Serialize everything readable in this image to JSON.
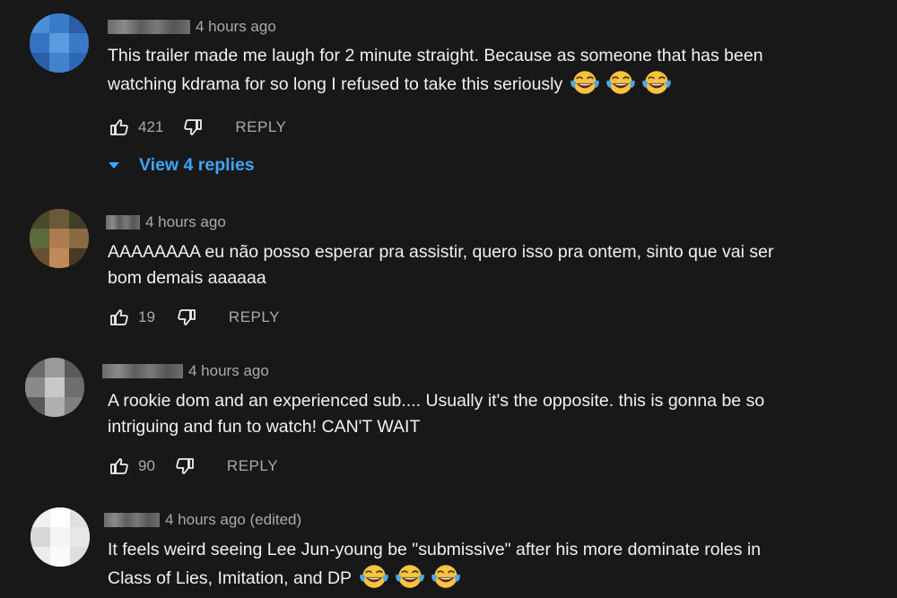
{
  "comments": [
    {
      "time": "4 hours ago",
      "text_lines": [
        "This trailer made me laugh for 2 minute straight. Because as someone that has been",
        "watching kdrama for so long I refused to take this seriously"
      ],
      "emoji": "face-with-tears-of-joy",
      "emoji_count": 3,
      "likes": "421",
      "reply_label": "REPLY",
      "view_replies_label": "View 4 replies",
      "avatar_color": "#3a78c4"
    },
    {
      "time": "4 hours ago",
      "text_lines": [
        "AAAAAAAA eu não posso esperar pra assistir, quero isso pra ontem, sinto que vai ser",
        "bom demais aaaaaa"
      ],
      "likes": "19",
      "reply_label": "REPLY",
      "avatar_color": "#6b5a3a"
    },
    {
      "time": "4 hours ago",
      "text_lines": [
        "A rookie dom and an experienced sub.... Usually it's the opposite. this is gonna be so",
        "intriguing and fun to watch! CAN'T WAIT"
      ],
      "likes": "90",
      "reply_label": "REPLY",
      "avatar_color": "#8a8a8a"
    },
    {
      "time": "4 hours ago (edited)",
      "text_lines": [
        "It feels weird seeing Lee Jun-young be \"submissive\" after his more dominate roles in",
        "Class of Lies, Imitation, and DP"
      ],
      "emoji": "face-with-tears-of-joy",
      "emoji_count": 3,
      "avatar_color": "#e8e8e8"
    }
  ],
  "colors": {
    "background": "#181818",
    "text": "#f1f1f1",
    "secondary_text": "#aaaaaa",
    "link": "#3ea6ff",
    "emoji_yellow": "#f6c343"
  },
  "icons": {
    "like": "thumbs-up-icon",
    "dislike": "thumbs-down-icon",
    "expand": "caret-down-icon"
  }
}
